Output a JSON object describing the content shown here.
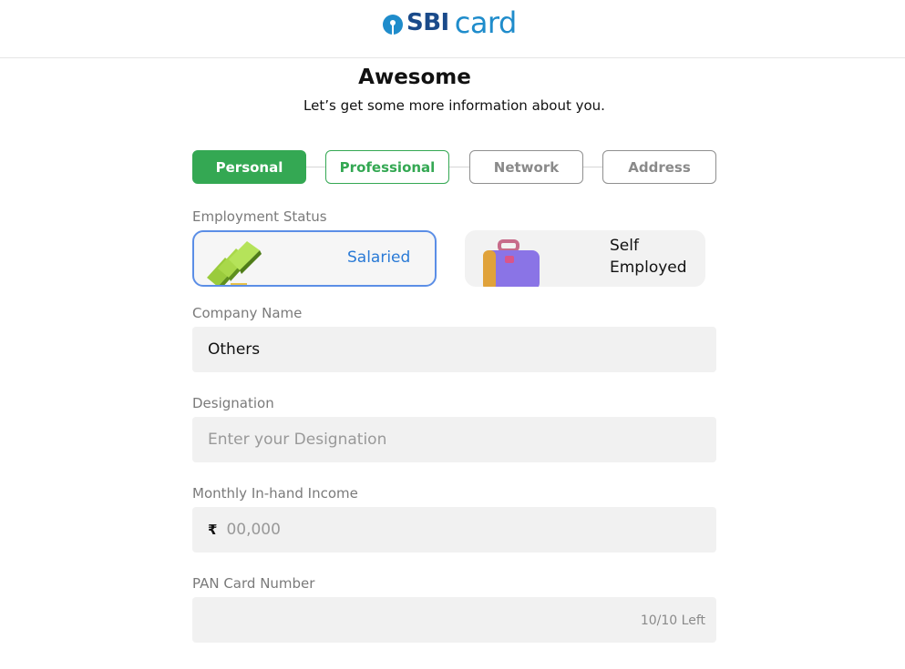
{
  "brand": {
    "sbi": "SBI",
    "card": "card"
  },
  "heading": {
    "title": "Awesome",
    "subtitle": "Let’s get some more information about you."
  },
  "steps": [
    {
      "label": "Personal",
      "state": "completed"
    },
    {
      "label": "Professional",
      "state": "current"
    },
    {
      "label": "Network",
      "state": "pending"
    },
    {
      "label": "Address",
      "state": "pending"
    }
  ],
  "employment": {
    "label": "Employment Status",
    "options": [
      {
        "label": "Salaried",
        "selected": true,
        "icon": "money-stack-icon"
      },
      {
        "label_line1": "Self",
        "label_line2": "Employed",
        "selected": false,
        "icon": "briefcase-icon"
      }
    ]
  },
  "company": {
    "label": "Company Name",
    "value": "Others"
  },
  "designation": {
    "label": "Designation",
    "placeholder": "Enter your Designation"
  },
  "income": {
    "label": "Monthly In-hand Income",
    "currency": "₹",
    "placeholder": "00,000"
  },
  "pan": {
    "label": "PAN Card Number",
    "counter": "10/10 Left"
  },
  "colors": {
    "primary_green": "#34a853",
    "selected_blue": "#5b8ee6",
    "brand_blue": "#1f8ccb",
    "brand_navy": "#1a4a8a"
  }
}
